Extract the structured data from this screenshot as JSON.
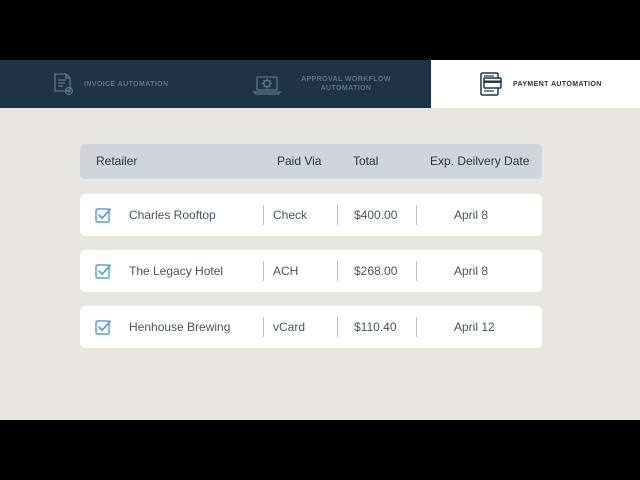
{
  "tabs": [
    {
      "label": "INVOICE AUTOMATION",
      "icon": "invoice-document-icon",
      "active": false
    },
    {
      "label": "APPROVAL WORKFLOW AUTOMATION",
      "icon": "approval-gear-laptop-icon",
      "active": false
    },
    {
      "label": "PAYMENT AUTOMATION",
      "icon": "payment-card-icon",
      "active": true
    }
  ],
  "table": {
    "headers": {
      "retailer": "Retailer",
      "paid_via": "Paid Via",
      "total": "Total",
      "date": "Exp. Deilvery Date"
    },
    "rows": [
      {
        "retailer": "Charles Rooftop",
        "paid_via": "Check",
        "total": "$400.00",
        "date": "April 8",
        "checked": true
      },
      {
        "retailer": "The Legacy Hotel",
        "paid_via": "ACH",
        "total": "$268.00",
        "date": "April 8",
        "checked": true
      },
      {
        "retailer": "Henhouse Brewing",
        "paid_via": "vCard",
        "total": "$110.40",
        "date": "April 12",
        "checked": true
      }
    ]
  },
  "colors": {
    "tabbar_bg": "#1d3446",
    "active_tab_bg": "#ffffff",
    "background": "#e7e6e1",
    "header_bg": "#d0d5db",
    "checkbox_accent": "#5b9fd4"
  }
}
